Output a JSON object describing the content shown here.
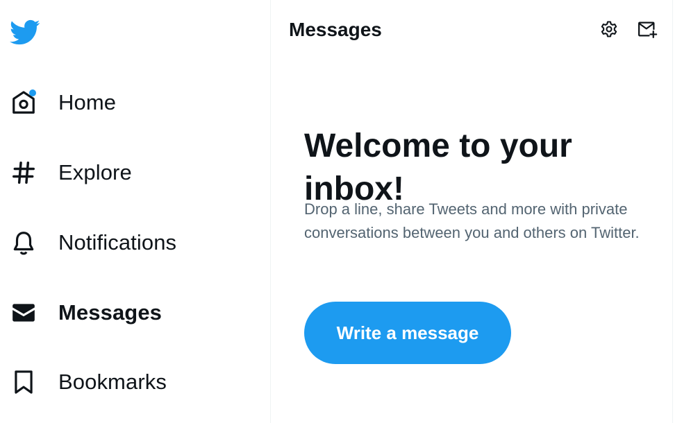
{
  "app": {
    "brand_color": "#1d9bf0",
    "logo_icon": "twitter-bird-icon"
  },
  "sidebar": {
    "items": [
      {
        "id": "home",
        "label": "Home",
        "icon": "home-icon",
        "has_notification_dot": true,
        "active": false
      },
      {
        "id": "explore",
        "label": "Explore",
        "icon": "hashtag-icon",
        "active": false
      },
      {
        "id": "notifications",
        "label": "Notifications",
        "icon": "bell-icon",
        "active": false
      },
      {
        "id": "messages",
        "label": "Messages",
        "icon": "envelope-icon",
        "active": true
      },
      {
        "id": "bookmarks",
        "label": "Bookmarks",
        "icon": "bookmark-icon",
        "active": false
      }
    ]
  },
  "messages_panel": {
    "title": "Messages",
    "settings_icon": "gear-icon",
    "new_message_icon": "new-message-icon",
    "welcome_title": "Welcome to your inbox!",
    "welcome_text": "Drop a line, share Tweets and more with private conversations between you and others on Twitter.",
    "write_button_label": "Write a message"
  }
}
